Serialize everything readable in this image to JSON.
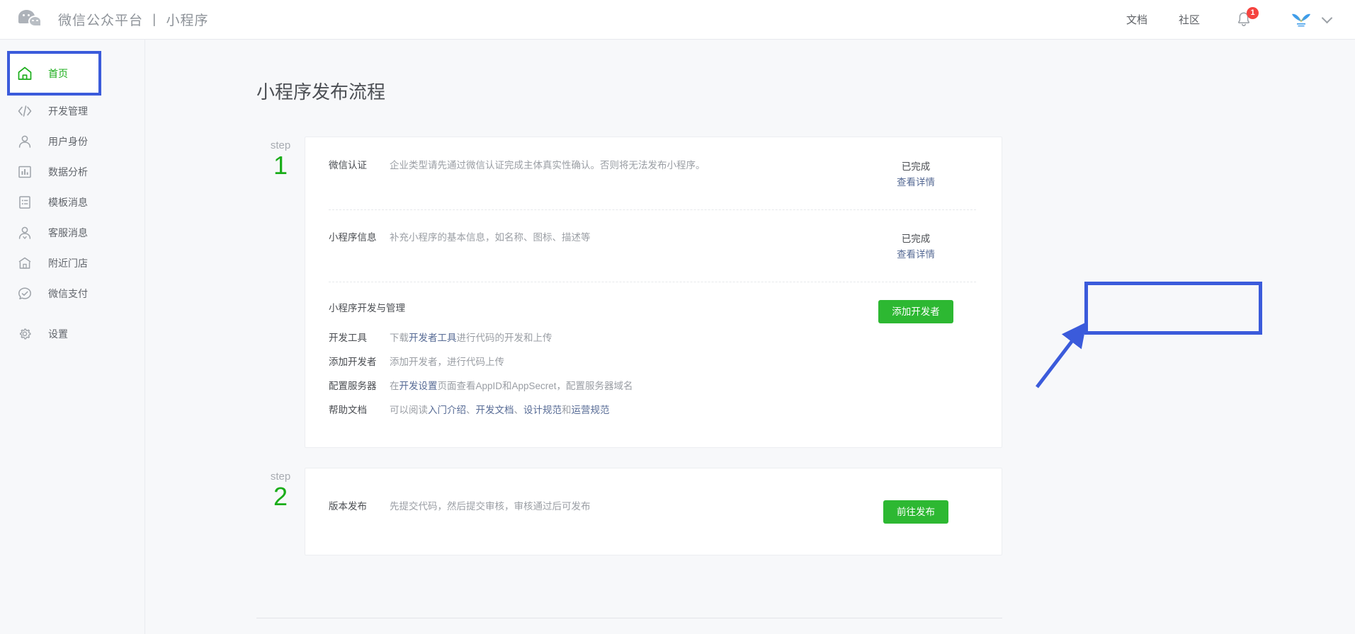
{
  "header": {
    "logo_icon": "wechat-logo-icon",
    "brand_title": "微信公众平台 丨 小程序",
    "links": [
      {
        "label": "文档",
        "name": "docs"
      },
      {
        "label": "社区",
        "name": "community"
      }
    ],
    "notification": {
      "icon": "bell-icon",
      "badge": "1"
    },
    "avatar": {
      "icon": "account-avatar-icon"
    },
    "chevron": "chevron-down-icon"
  },
  "sidebar": {
    "items": [
      {
        "label": "首页",
        "icon": "home-icon",
        "active": true
      },
      {
        "label": "开发管理",
        "icon": "code-icon",
        "active": false
      },
      {
        "label": "用户身份",
        "icon": "user-icon",
        "active": false
      },
      {
        "label": "数据分析",
        "icon": "chart-bar-icon",
        "active": false
      },
      {
        "label": "模板消息",
        "icon": "template-message-icon",
        "active": false
      },
      {
        "label": "客服消息",
        "icon": "customer-service-icon",
        "active": false
      },
      {
        "label": "附近门店",
        "icon": "store-icon",
        "active": false
      },
      {
        "label": "微信支付",
        "icon": "wechat-pay-icon",
        "active": false
      },
      {
        "label": "设置",
        "icon": "gear-icon",
        "active": false
      }
    ]
  },
  "main": {
    "page_title": "小程序发布流程",
    "steps": [
      {
        "step_word": "step",
        "step_number": "1",
        "rows": [
          {
            "label": "微信认证",
            "desc": "企业类型请先通过微信认证完成主体真实性确认。否则将无法发布小程序。",
            "status": "已完成",
            "status_link": "查看详情"
          },
          {
            "label": "小程序信息",
            "desc": "补充小程序的基本信息，如名称、图标、描述等",
            "status": "已完成",
            "status_link": "查看详情"
          }
        ],
        "dev_section": {
          "title": "小程序开发与管理",
          "button": "添加开发者",
          "lines": [
            {
              "key": "开发工具",
              "parts": [
                {
                  "text": "下载",
                  "link": false
                },
                {
                  "text": "开发者工具",
                  "link": true
                },
                {
                  "text": "进行代码的开发和上传",
                  "link": false
                }
              ]
            },
            {
              "key": "添加开发者",
              "parts": [
                {
                  "text": "添加开发者，进行代码上传",
                  "link": false
                }
              ]
            },
            {
              "key": "配置服务器",
              "parts": [
                {
                  "text": "在",
                  "link": false
                },
                {
                  "text": "开发设置",
                  "link": true
                },
                {
                  "text": "页面查看AppID和AppSecret，配置服务器域名",
                  "link": false
                }
              ]
            },
            {
              "key": "帮助文档",
              "parts": [
                {
                  "text": "可以阅读",
                  "link": false
                },
                {
                  "text": "入门介绍",
                  "link": true
                },
                {
                  "text": "、",
                  "link": false
                },
                {
                  "text": "开发文档",
                  "link": true
                },
                {
                  "text": "、",
                  "link": false
                },
                {
                  "text": "设计规范",
                  "link": true
                },
                {
                  "text": "和",
                  "link": false
                },
                {
                  "text": "运营规范",
                  "link": true
                }
              ]
            }
          ]
        }
      },
      {
        "step_word": "step",
        "step_number": "2",
        "rows": [
          {
            "label": "版本发布",
            "desc": "先提交代码，然后提交审核，审核通过后可发布",
            "button": "前往发布"
          }
        ]
      }
    ]
  },
  "annotations": {
    "highlight_color": "#3b5bdb",
    "boxes": [
      "sidebar-home-highlight",
      "add-developer-highlight"
    ],
    "arrow": "pointer-arrow"
  },
  "colors": {
    "brand_green": "#1aad19",
    "button_green": "#2db832",
    "link_blue": "#576b95",
    "annotation_blue": "#3b5bdb",
    "badge_red": "#f5433f",
    "page_bg": "#f7f8fa"
  }
}
